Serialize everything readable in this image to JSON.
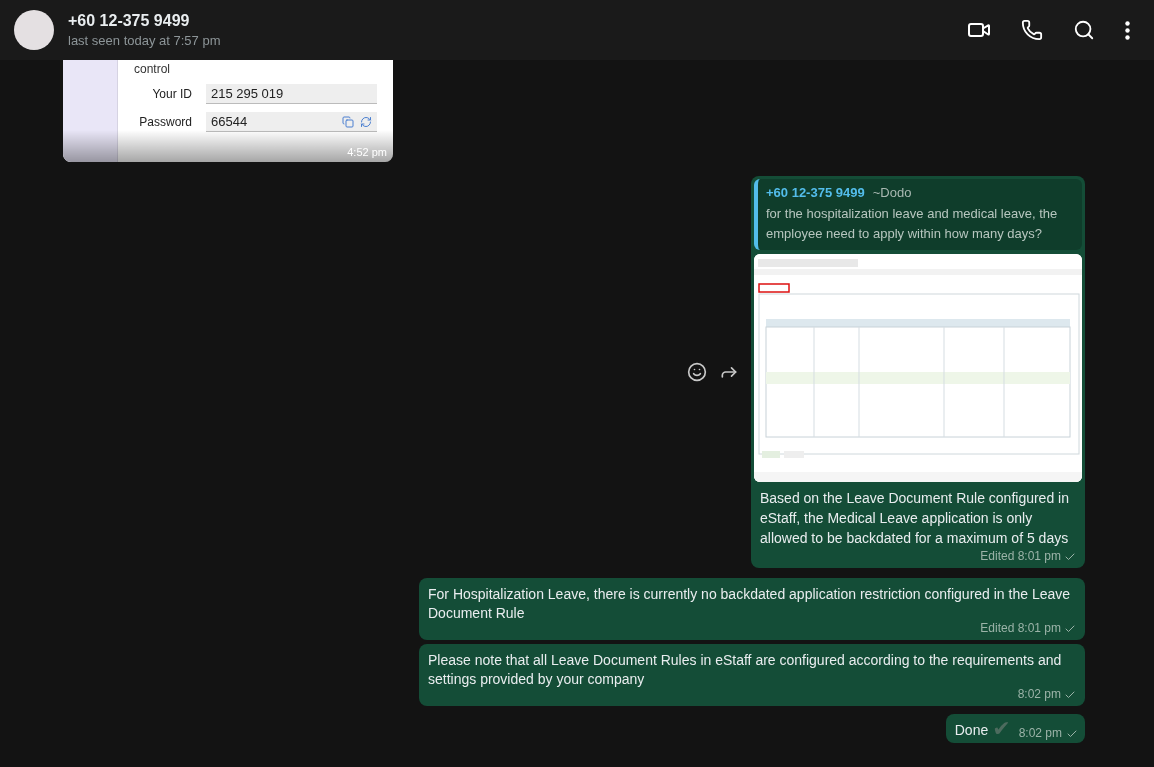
{
  "header": {
    "title": "+60 12-375 9499",
    "subtitle": "last seen today at 7:57 pm"
  },
  "messages": [
    {
      "kind": "form-image",
      "form": {
        "heading": "control",
        "fields": [
          {
            "label": "Your ID",
            "value": "215 295 019",
            "kind": "text"
          },
          {
            "label": "Password",
            "value": "66544",
            "kind": "password"
          }
        ]
      },
      "meta": "4:52 pm"
    },
    {
      "kind": "quote-image",
      "quote": {
        "author": "+60 12-375 9499",
        "name": "~Dodo",
        "text": "for the hospitalization leave and medical leave, the employee need to apply within how many days?"
      },
      "text": "Based on the Leave Document Rule configured in eStaff, the Medical Leave application is only allowed to be backdated for a maximum of 5 days",
      "meta": "Edited 8:01 pm",
      "sent": true
    },
    {
      "kind": "text",
      "text": "For Hospitalization Leave, there is currently no backdated application restriction configured in the Leave Document Rule",
      "meta": "Edited 8:01 pm",
      "sent": true
    },
    {
      "kind": "text",
      "text": "Please note that all Leave Document Rules in eStaff are configured according to the requirements and settings provided by your company",
      "meta": "8:02 pm",
      "sent": true
    },
    {
      "kind": "short",
      "text": "Done",
      "emoji": "✔",
      "meta": "8:02 pm",
      "sent": true
    }
  ]
}
